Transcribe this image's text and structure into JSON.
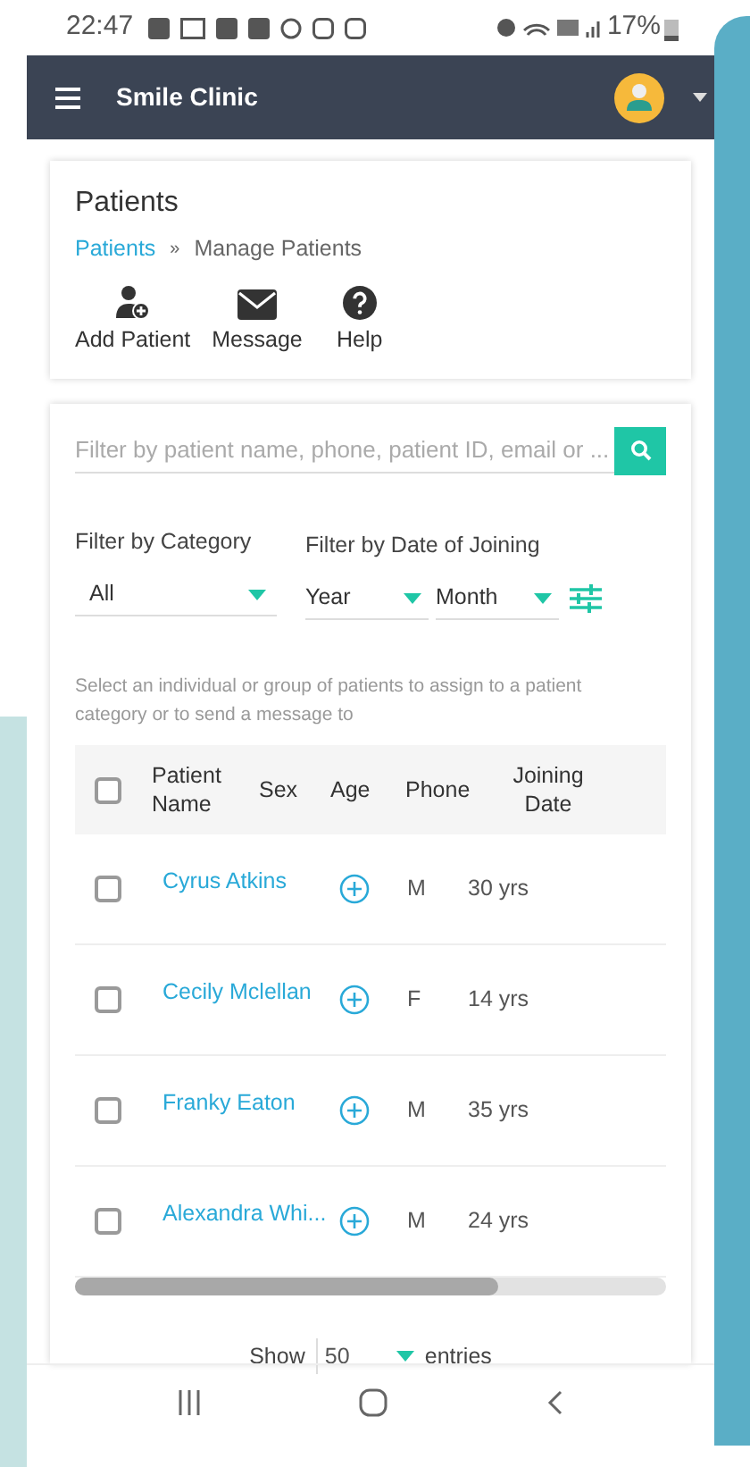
{
  "status_bar": {
    "time": "22:47",
    "battery": "17%"
  },
  "app_bar": {
    "title": "Smile Clinic"
  },
  "page": {
    "title": "Patients",
    "breadcrumb": [
      {
        "label": "Patients",
        "kind": "link"
      },
      {
        "label": "Manage Patients",
        "kind": "current"
      }
    ],
    "separator": "»",
    "actions": [
      {
        "label": "Add Patient",
        "kind": "add-user"
      },
      {
        "label": "Message",
        "kind": "mail"
      },
      {
        "label": "Help",
        "kind": "help"
      }
    ]
  },
  "filters": {
    "search": {
      "placeholder": "Filter by patient name, phone, patient ID, email or ..."
    },
    "category": {
      "label": "Filter by Category",
      "value": "All"
    },
    "date": {
      "label": "Filter by Date of Joining",
      "year": "Year",
      "month": "Month"
    }
  },
  "hint": "Select an individual or group of patients to assign to a patient category or to send a message to",
  "table": {
    "select_all": {
      "checked": false
    },
    "columns": [
      "Patient Name",
      "Sex",
      "Age",
      "Phone",
      "Joining Date"
    ],
    "rows": [
      {
        "checked": false,
        "name": "Cyrus Atkins",
        "sex": "M",
        "age": "30 yrs"
      },
      {
        "checked": false,
        "name": "Cecily Mclellan",
        "sex": "F",
        "age": "14 yrs"
      },
      {
        "checked": false,
        "name": "Franky Eaton",
        "sex": "M",
        "age": "35 yrs"
      },
      {
        "checked": false,
        "name": "Alexandra Whi...",
        "sex": "M",
        "age": "24 yrs"
      }
    ]
  },
  "pagination": {
    "show": "Show",
    "value": "50",
    "entries": "entries"
  }
}
